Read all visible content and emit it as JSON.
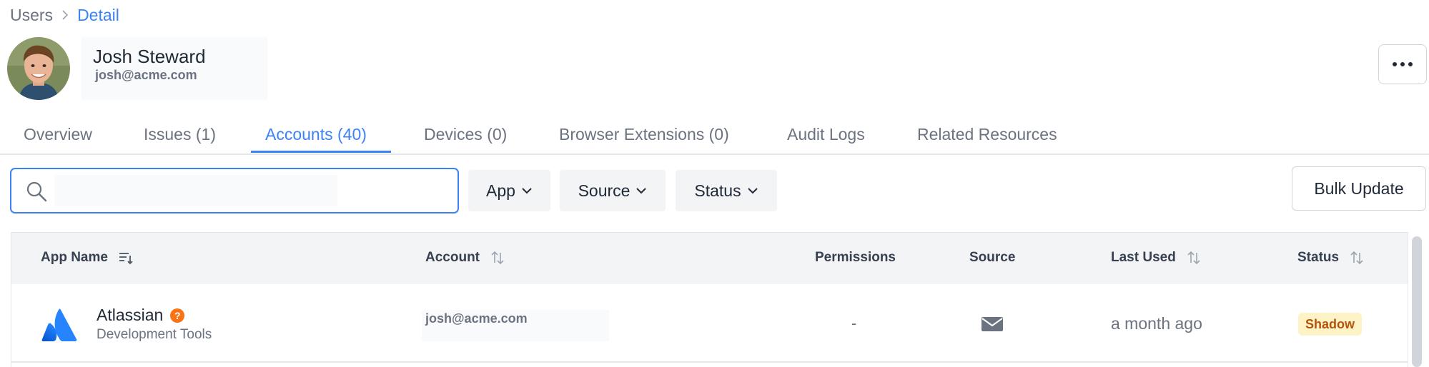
{
  "breadcrumb": {
    "parent": "Users",
    "current": "Detail"
  },
  "user": {
    "name": "Josh Steward",
    "email": "josh@acme.com"
  },
  "tabs": [
    {
      "label": "Overview"
    },
    {
      "label": "Issues (1)"
    },
    {
      "label": "Accounts (40)"
    },
    {
      "label": "Devices (0)"
    },
    {
      "label": "Browser Extensions (0)"
    },
    {
      "label": "Audit Logs"
    },
    {
      "label": "Related Resources"
    }
  ],
  "active_tab": "Accounts (40)",
  "search": {
    "value": "",
    "placeholder": ""
  },
  "filters": [
    {
      "label": "App"
    },
    {
      "label": "Source"
    },
    {
      "label": "Status"
    }
  ],
  "toolbar": {
    "bulk_update_label": "Bulk Update"
  },
  "table": {
    "columns": [
      {
        "label": "App Name",
        "icon": "sort-lines-icon"
      },
      {
        "label": "Account",
        "icon": "sort-arrows-icon"
      },
      {
        "label": "Permissions"
      },
      {
        "label": "Source"
      },
      {
        "label": "Last Used",
        "icon": "sort-arrows-icon"
      },
      {
        "label": "Status",
        "icon": "sort-arrows-icon"
      }
    ],
    "rows": [
      {
        "app_name": "Atlassian",
        "app_icon": "atlassian-logo-icon",
        "issue_badge": "?",
        "category": "Development Tools",
        "account": "josh@acme.com",
        "permissions": "-",
        "source_icon": "mail-icon",
        "last_used": "a month ago",
        "status": "Shadow"
      }
    ]
  },
  "colors": {
    "accent": "#3b82f6",
    "status_shadow_bg": "#fef3c7",
    "status_shadow_text": "#b45309",
    "issue_badge": "#f97316",
    "atlassian_blue": "#2684ff"
  }
}
